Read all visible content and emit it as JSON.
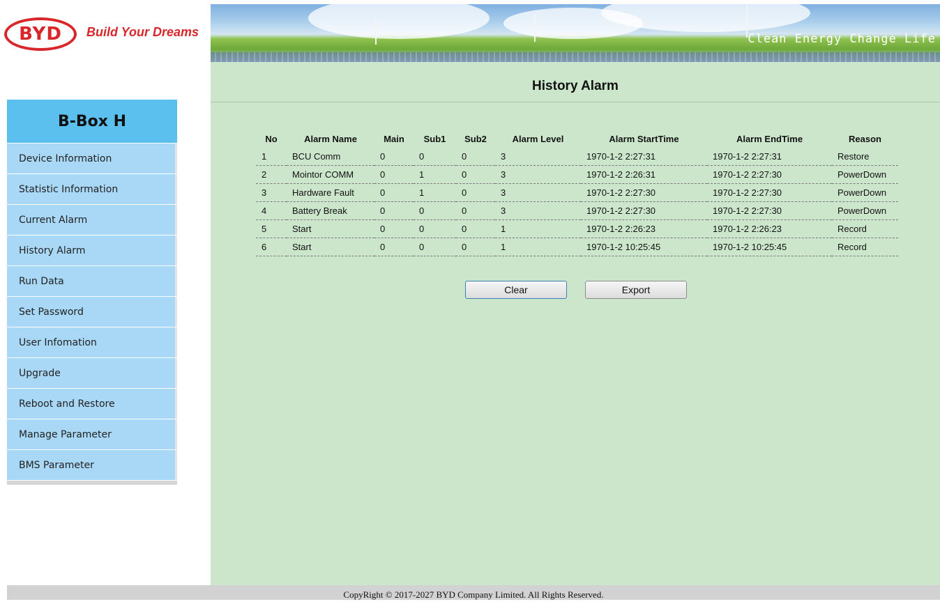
{
  "brand": {
    "logo_text": "BYD",
    "tagline": "Build Your Dreams",
    "color": "#d9262b"
  },
  "banner": {
    "slogan": "Clean Energy Change Life"
  },
  "sidebar": {
    "title": "B-Box H",
    "items": [
      {
        "label": "Device Information"
      },
      {
        "label": "Statistic Information"
      },
      {
        "label": "Current Alarm"
      },
      {
        "label": "History Alarm"
      },
      {
        "label": "Run Data"
      },
      {
        "label": "Set Password"
      },
      {
        "label": "User Infomation"
      },
      {
        "label": "Upgrade"
      },
      {
        "label": "Reboot and Restore"
      },
      {
        "label": "Manage Parameter"
      },
      {
        "label": "BMS Parameter"
      }
    ]
  },
  "main": {
    "title": "History Alarm",
    "table": {
      "headers": [
        "No",
        "Alarm Name",
        "Main",
        "Sub1",
        "Sub2",
        "Alarm Level",
        "Alarm StartTime",
        "Alarm EndTime",
        "Reason"
      ],
      "rows": [
        [
          "1",
          "BCU Comm",
          "0",
          "0",
          "0",
          "3",
          "1970-1-2 2:27:31",
          "1970-1-2 2:27:31",
          "Restore"
        ],
        [
          "2",
          "Mointor COMM",
          "0",
          "1",
          "0",
          "3",
          "1970-1-2 2:26:31",
          "1970-1-2 2:27:30",
          "PowerDown"
        ],
        [
          "3",
          "Hardware Fault",
          "0",
          "1",
          "0",
          "3",
          "1970-1-2 2:27:30",
          "1970-1-2 2:27:30",
          "PowerDown"
        ],
        [
          "4",
          "Battery Break",
          "0",
          "0",
          "0",
          "3",
          "1970-1-2 2:27:30",
          "1970-1-2 2:27:30",
          "PowerDown"
        ],
        [
          "5",
          "Start",
          "0",
          "0",
          "0",
          "1",
          "1970-1-2 2:26:23",
          "1970-1-2 2:26:23",
          "Record"
        ],
        [
          "6",
          "Start",
          "0",
          "0",
          "0",
          "1",
          "1970-1-2 10:25:45",
          "1970-1-2 10:25:45",
          "Record"
        ]
      ]
    },
    "buttons": {
      "clear": "Clear",
      "export": "Export"
    }
  },
  "footer": {
    "text": "CopyRight © 2017-2027 BYD Company Limited. All Rights Reserved."
  },
  "colors": {
    "main_bg": "#cce6cc",
    "sidebar_header": "#5bc0ee",
    "sidebar_item": "#a8d8f6",
    "footer_bg": "#d2d2d2"
  }
}
